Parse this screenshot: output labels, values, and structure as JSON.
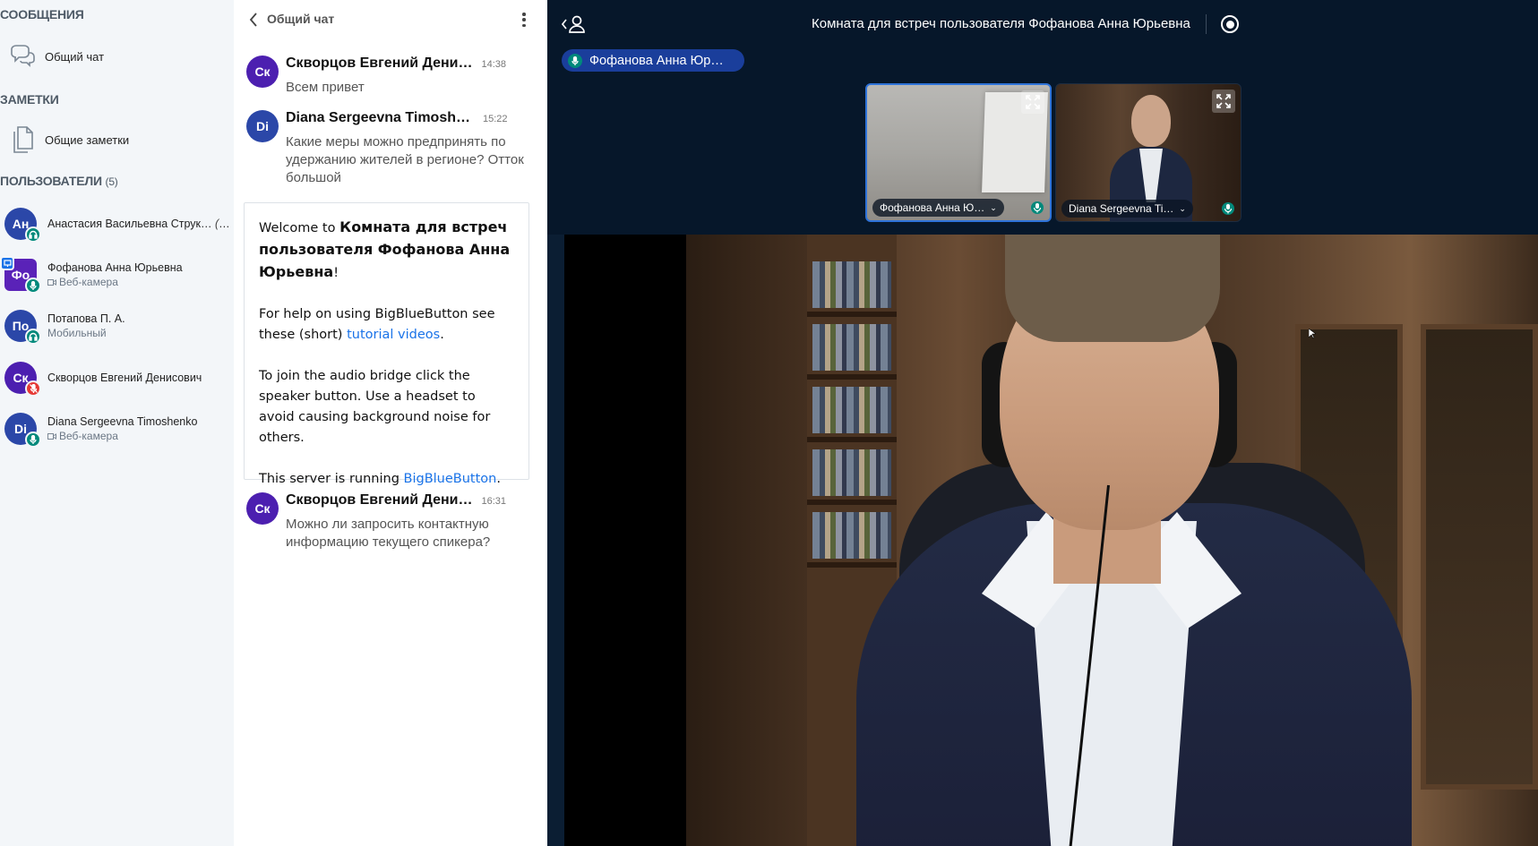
{
  "sidebar": {
    "messages_title": "СООБЩЕНИЯ",
    "public_chat_label": "Общий чат",
    "notes_title": "ЗАМЕТКИ",
    "shared_notes_label": "Общие заметки",
    "users_title": "ПОЛЬЗОВАТЕЛИ",
    "users_count": "(5)",
    "users": [
      {
        "initials": "Ан",
        "name": "Анастасия Васильевна Струк…",
        "you": "(Вы)",
        "sub": "",
        "color": "#2b47a8",
        "status": "headset"
      },
      {
        "initials": "Фо",
        "name": "Фофанова Анна Юрьевна",
        "sub": "Веб-камера",
        "color": "#5a22b8",
        "status": "mic",
        "presenter": true
      },
      {
        "initials": "По",
        "name": "Потапова П. А.",
        "sub": "Мобильный",
        "color": "#2b47a8",
        "status": "headset"
      },
      {
        "initials": "Ск",
        "name": "Скворцов Евгений Денисович",
        "sub": "",
        "color": "#4c1fb0",
        "status": "muted"
      },
      {
        "initials": "Di",
        "name": "Diana Sergeevna Timoshenko",
        "sub": "Веб-камера",
        "color": "#2b47a8",
        "status": "mic"
      }
    ]
  },
  "chat": {
    "title": "Общий чат",
    "messages": [
      {
        "initials": "Ск",
        "author": "Скворцов Евгений Дени…",
        "time": "14:38",
        "text": "Всем привет",
        "color": "#4c1fb0"
      },
      {
        "initials": "Di",
        "author": "Diana Sergeevna Timoshenko",
        "time": "15:22",
        "text": "Какие меры можно предпринять по удержанию жителей в регионе? Отток большой",
        "color": "#2b47a8"
      },
      {
        "initials": "Ск",
        "author": "Скворцов Евгений Дени…",
        "time": "16:31",
        "text": "Можно ли запросить контактную информацию текущего спикера?",
        "color": "#4c1fb0"
      }
    ],
    "welcome": {
      "prefix": "Welcome to ",
      "room": "Комната для встреч пользователя Фофанова Анна Юрьевна",
      "suffix": "!",
      "help_prefix": "For help on using BigBlueButton see these (short) ",
      "help_link": "tutorial videos",
      "help_suffix": ".",
      "audio": "To join the audio bridge click the speaker button. Use a headset to avoid causing background noise for others.",
      "server_prefix": "This server is running ",
      "server_link": "BigBlueButton",
      "server_suffix": "."
    }
  },
  "stage": {
    "room_title": "Комната для встреч пользователя Фофанова Анна Юрьевна",
    "talker": "Фофанова Анна Юр…",
    "thumbs": [
      {
        "name": "Фофанова Анна Ю…"
      },
      {
        "name": "Diana Sergeevna Ti…"
      }
    ],
    "colors": {
      "stage_bg": "#06172a",
      "talker_bg": "#1a3e9b",
      "mic_green": "#00897b",
      "muted_red": "#e53935",
      "link": "#1a73e8"
    }
  }
}
